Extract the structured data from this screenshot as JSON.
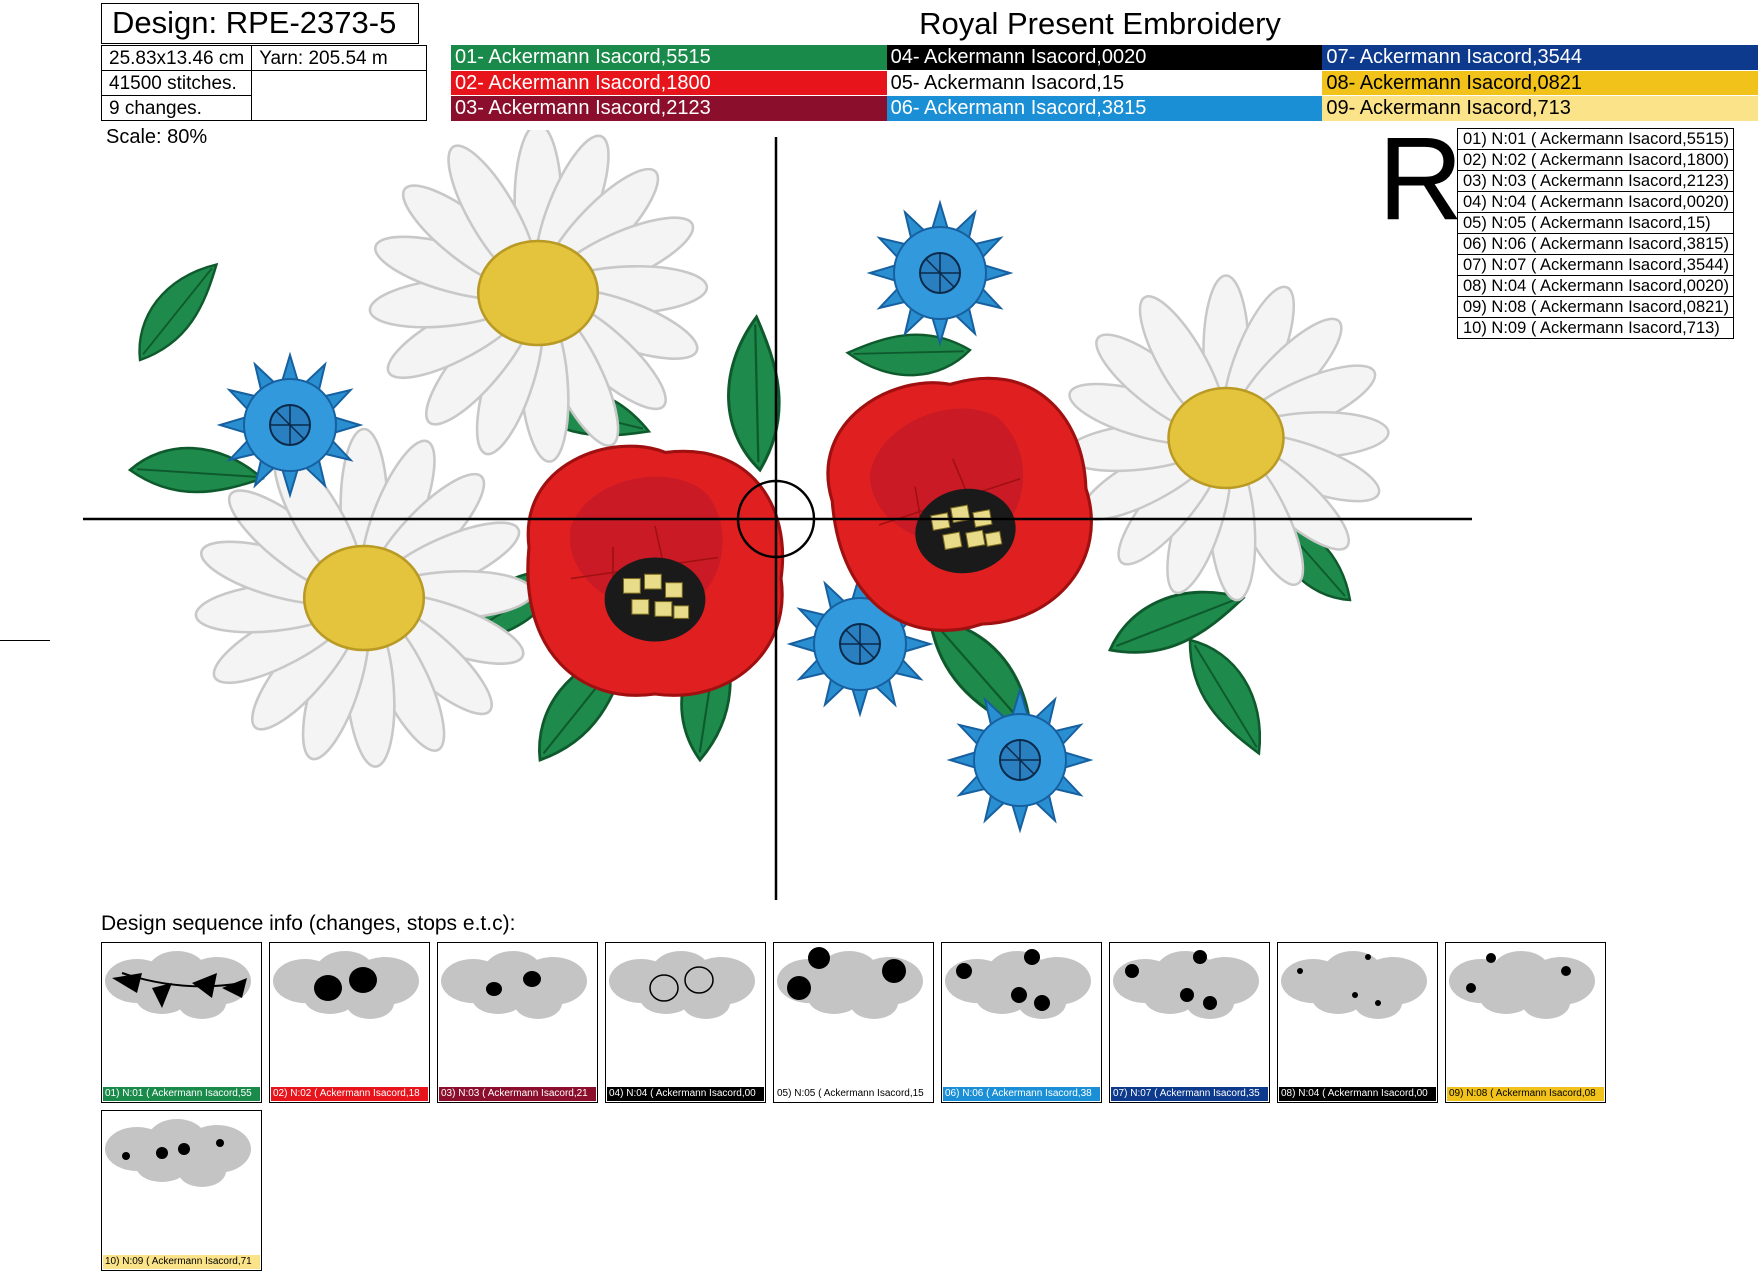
{
  "design": {
    "title": "Design: RPE-2373-5"
  },
  "company": "Royal Present Embroidery",
  "specs": {
    "size": "25.83x13.46 cm",
    "yarn": "Yarn: 205.54 m",
    "stitches": "41500 stitches.",
    "changes": "9 changes."
  },
  "colors": [
    {
      "label": "01- Ackermann Isacord,5515",
      "bg": "#1a8a4a",
      "fg": "#ffffff"
    },
    {
      "label": "02- Ackermann Isacord,1800",
      "bg": "#e8141c",
      "fg": "#ffffff"
    },
    {
      "label": "03- Ackermann Isacord,2123",
      "bg": "#8b0f2c",
      "fg": "#ffffff"
    },
    {
      "label": "04- Ackermann Isacord,0020",
      "bg": "#000000",
      "fg": "#ffffff"
    },
    {
      "label": "05- Ackermann Isacord,15",
      "bg": "#ffffff",
      "fg": "#000000"
    },
    {
      "label": "06- Ackermann Isacord,3815",
      "bg": "#1a8fd6",
      "fg": "#ffffff"
    },
    {
      "label": "07- Ackermann Isacord,3544",
      "bg": "#0d3a8c",
      "fg": "#ffffff"
    },
    {
      "label": "08- Ackermann Isacord,0821",
      "bg": "#f0c21a",
      "fg": "#000000"
    },
    {
      "label": "09- Ackermann Isacord,713",
      "bg": "#fbe38a",
      "fg": "#000000"
    }
  ],
  "scale": "Scale: 80%",
  "orientation_mark": "R",
  "sequence": [
    "01) N:01 ( Ackermann Isacord,5515)",
    "02) N:02 ( Ackermann Isacord,1800)",
    "03) N:03 ( Ackermann Isacord,2123)",
    "04) N:04 ( Ackermann Isacord,0020)",
    "05) N:05 ( Ackermann Isacord,15)",
    "06) N:06 ( Ackermann Isacord,3815)",
    "07) N:07 ( Ackermann Isacord,3544)",
    "08) N:04 ( Ackermann Isacord,0020)",
    "09) N:08 ( Ackermann Isacord,0821)",
    "10) N:09 ( Ackermann Isacord,713)"
  ],
  "sequence_title": "Design sequence info (changes, stops e.t.c):",
  "thumbnails": [
    {
      "label": "01) N:01 ( Ackermann Isacord,55",
      "bg": "#1a8a4a",
      "fg": "#ffffff"
    },
    {
      "label": "02) N:02 ( Ackermann Isacord,18",
      "bg": "#e8141c",
      "fg": "#ffffff"
    },
    {
      "label": "03) N:03 ( Ackermann Isacord,21",
      "bg": "#8b0f2c",
      "fg": "#ffffff"
    },
    {
      "label": "04) N:04 ( Ackermann Isacord,00",
      "bg": "#000000",
      "fg": "#ffffff"
    },
    {
      "label": "05) N:05 ( Ackermann Isacord,15",
      "bg": "#ffffff",
      "fg": "#000000"
    },
    {
      "label": "06) N:06 ( Ackermann Isacord,38",
      "bg": "#1a8fd6",
      "fg": "#ffffff"
    },
    {
      "label": "07) N:07 ( Ackermann Isacord,35",
      "bg": "#0d3a8c",
      "fg": "#ffffff"
    },
    {
      "label": "08) N:04 ( Ackermann Isacord,00",
      "bg": "#000000",
      "fg": "#ffffff"
    },
    {
      "label": "09) N:08 ( Ackermann Isacord,08",
      "bg": "#f0c21a",
      "fg": "#000000"
    },
    {
      "label": "10) N:09 ( Ackermann Isacord,71",
      "bg": "#fbe38a",
      "fg": "#000000"
    }
  ]
}
